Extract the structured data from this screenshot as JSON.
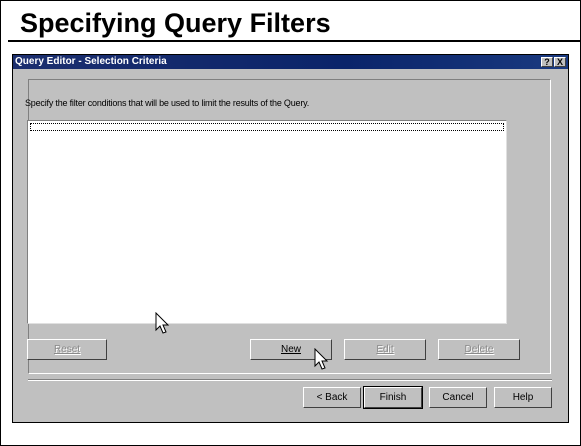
{
  "slide": {
    "title": "Specifying Query Filters"
  },
  "dialog": {
    "title": "Query Editor - Selection Criteria",
    "help_button": "?",
    "close_button": "X",
    "instructions": "Specify the filter conditions that will be used to limit the results of the Query.",
    "filter_list": {
      "rows": [
        ""
      ]
    },
    "buttons": {
      "reset": "Reset",
      "new": "New",
      "edit": "Edit",
      "delete": "Delete"
    },
    "footer_buttons": {
      "back": "< Back",
      "finish": "Finish",
      "cancel": "Cancel",
      "help": "Help"
    }
  },
  "icons": [
    "arrow-cursor-icon",
    "help-icon",
    "close-icon"
  ]
}
